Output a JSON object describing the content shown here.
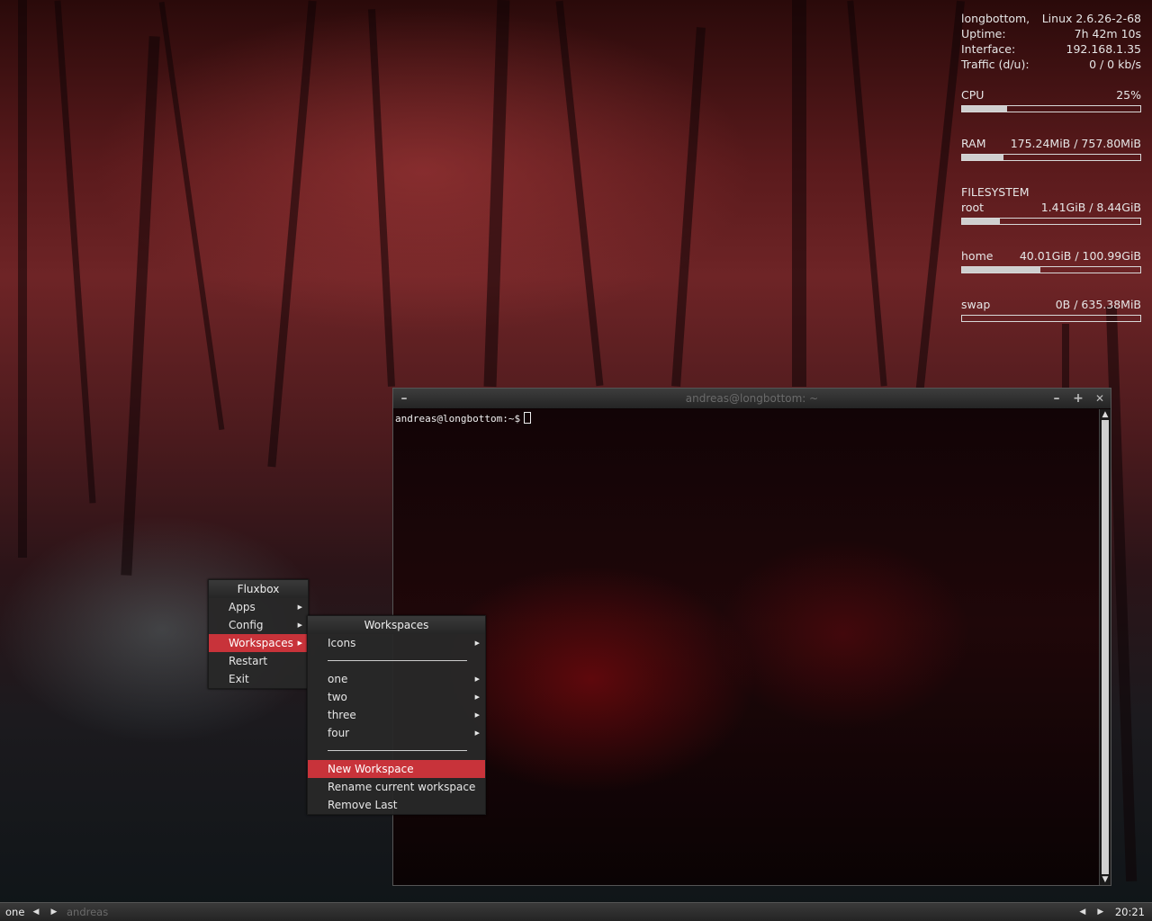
{
  "conky": {
    "host": "longbottom,",
    "kernel": "Linux 2.6.26-2-68",
    "uptime_label": "Uptime:",
    "uptime": "7h 42m 10s",
    "interface_label": "Interface:",
    "interface": "192.168.1.35",
    "traffic_label": "Traffic (d/u):",
    "traffic": "0 / 0 kb/s",
    "cpu_label": "CPU",
    "cpu_value": "25%",
    "cpu_fraction": 0.25,
    "ram_label": "RAM",
    "ram_value": "175.24MiB / 757.80MiB",
    "ram_fraction": 0.23,
    "filesystem_label": "FILESYSTEM",
    "root_label": "root",
    "root_value": "1.41GiB / 8.44GiB",
    "root_fraction": 0.21,
    "home_label": "home",
    "home_value": "40.01GiB / 100.99GiB",
    "home_fraction": 0.44,
    "swap_label": "swap",
    "swap_value": "0B / 635.38MiB",
    "swap_fraction": 0.0
  },
  "terminal": {
    "title": "andreas@longbottom: ~",
    "minimize_glyph": "–",
    "maximize_glyph": "+",
    "close_glyph": "✕",
    "menu_glyph": "–",
    "prompt": "andreas@longbottom:~$"
  },
  "root_menu": {
    "title": "Fluxbox",
    "items": [
      "Apps",
      "Config",
      "Workspaces",
      "Restart",
      "Exit"
    ],
    "selected": "Workspaces"
  },
  "workspaces_menu": {
    "title": "Workspaces",
    "icons": "Icons",
    "workspaces": [
      "one",
      "two",
      "three",
      "four"
    ],
    "actions": [
      "New Workspace",
      "Rename current workspace",
      "Remove Last"
    ],
    "selected": "New Workspace"
  },
  "toolbar": {
    "workspace": "one",
    "task": "andreas",
    "clock": "20:21"
  },
  "colors": {
    "highlight": "#c8333a",
    "menu_bg": "#282828"
  }
}
